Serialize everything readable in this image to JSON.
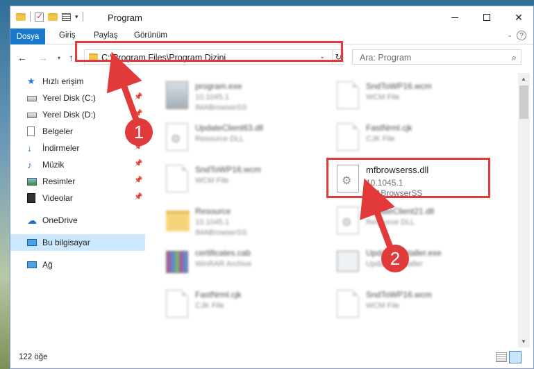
{
  "title_bar": {
    "title": "Program",
    "minimize_icon": "minimize-icon",
    "maximize_icon": "maximize-icon",
    "close_icon": "close-icon"
  },
  "ribbon": {
    "tabs": [
      "Dosya",
      "Giriş",
      "Paylaş",
      "Görünüm"
    ],
    "help": "?"
  },
  "address": {
    "path": "C:\\Program Files\\Program Dizini"
  },
  "search": {
    "placeholder": "Ara: Program"
  },
  "sidebar": {
    "items": [
      {
        "label": "Hızlı erişim",
        "icon": "star-icon"
      },
      {
        "label": "Yerel Disk (C:)",
        "icon": "drive-icon",
        "pinned": true
      },
      {
        "label": "Yerel Disk (D:)",
        "icon": "drive-icon",
        "pinned": true
      },
      {
        "label": "Belgeler",
        "icon": "documents-icon",
        "pinned": true
      },
      {
        "label": "İndirmeler",
        "icon": "download-icon",
        "pinned": true
      },
      {
        "label": "Müzik",
        "icon": "music-icon",
        "pinned": true
      },
      {
        "label": "Resimler",
        "icon": "pictures-icon",
        "pinned": true
      },
      {
        "label": "Videolar",
        "icon": "videos-icon",
        "pinned": true
      },
      {
        "label": "OneDrive",
        "icon": "cloud-icon"
      },
      {
        "label": "Bu bilgisayar",
        "icon": "computer-icon",
        "selected": true
      },
      {
        "label": "Ağ",
        "icon": "network-icon"
      }
    ]
  },
  "files": [
    {
      "name": "program.exe",
      "line2": "10.1045.1",
      "line3": "IMABrowserSS",
      "icon": "exe-icon"
    },
    {
      "name": "SndToWP16.wcm",
      "line2": "WCM File",
      "line3": "",
      "icon": "document-icon"
    },
    {
      "name": "UpdateClient63.dll",
      "line2": "Resource DLL",
      "line3": "",
      "icon": "dll-icon"
    },
    {
      "name": "FastNrml.cjk",
      "line2": "CJK File",
      "line3": "",
      "icon": "document-icon"
    },
    {
      "name": "SndToWP16.wcm",
      "line2": "WCM File",
      "line3": "",
      "icon": "document-icon"
    },
    {
      "name": "mfbrowserss.dll",
      "line2": "10.1045.1",
      "line3": "IMABrowserSS",
      "icon": "dll-icon"
    },
    {
      "name": "Resource",
      "line2": "10.1045.1",
      "line3": "IMABrowserSS",
      "icon": "folder-icon"
    },
    {
      "name": "UpdateClient21.dll",
      "line2": "Resource DLL",
      "line3": "",
      "icon": "dll-icon"
    },
    {
      "name": "certificates.cab",
      "line2": "WinRAR Archive",
      "line3": "",
      "icon": "archive-icon"
    },
    {
      "name": "UpdatesInstaller.exe",
      "line2": "Updates installer",
      "line3": "",
      "icon": "installer-icon"
    },
    {
      "name": "FastNrml.cjk",
      "line2": "CJK File",
      "line3": "",
      "icon": "document-icon"
    },
    {
      "name": "SndToWP16.wcm",
      "line2": "WCM File",
      "line3": "",
      "icon": "document-icon"
    }
  ],
  "status": {
    "count": "122 öğe"
  },
  "annotations": {
    "step1": "1",
    "step2": "2",
    "color": "#e23a3a"
  }
}
